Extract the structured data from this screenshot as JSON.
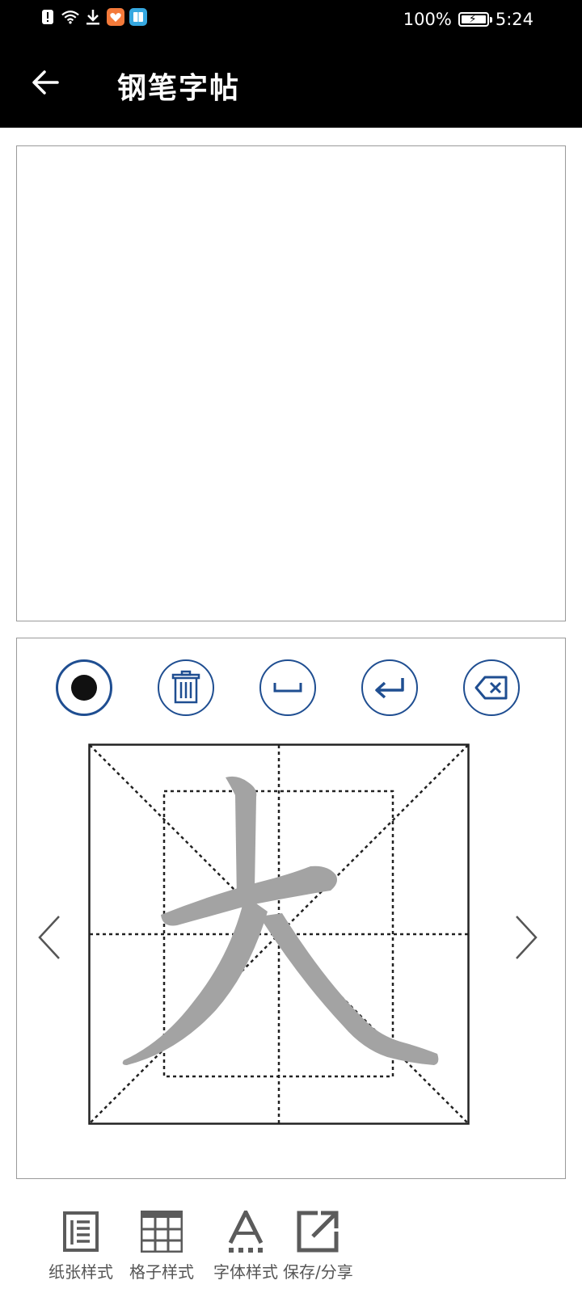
{
  "status_bar": {
    "battery": "100%",
    "time": "5:24"
  },
  "app_bar": {
    "title": "钢笔字帖"
  },
  "editor": {
    "current_char": "大",
    "buttons": [
      "record-dot",
      "trash",
      "space",
      "enter",
      "backspace"
    ]
  },
  "toolbar": {
    "paper_style": "纸张样式",
    "grid_style": "格子样式",
    "font_style": "字体样式",
    "save_share": "保存/分享"
  },
  "colors": {
    "accent": "#1f4e91",
    "char_gray": "#a3a3a3",
    "icon_gray": "#5b5b5b"
  }
}
